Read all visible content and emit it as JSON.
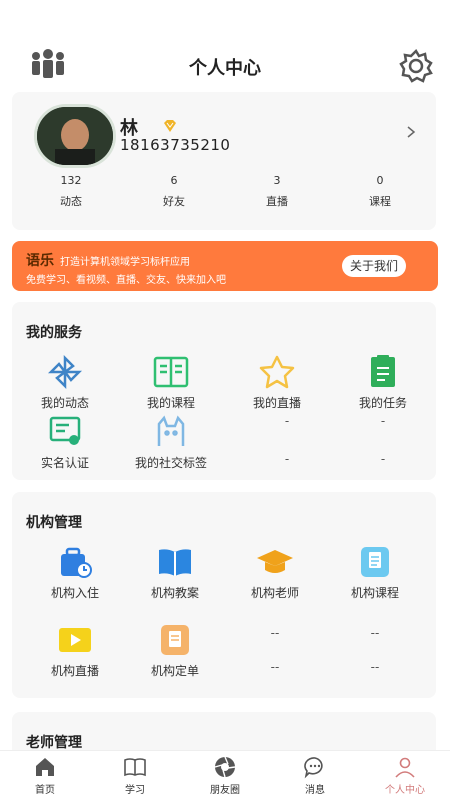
{
  "header": {
    "title": "个人中心",
    "left_icon": "people-icon",
    "right_icon": "gear-icon"
  },
  "profile": {
    "name": "林",
    "phone": "18163735210",
    "badge_icon": "vip-diamond-icon",
    "stats": [
      {
        "value": "132",
        "label": "动态"
      },
      {
        "value": "6",
        "label": "好友"
      },
      {
        "value": "3",
        "label": "直播"
      },
      {
        "value": "0",
        "label": "课程"
      }
    ]
  },
  "banner": {
    "brand": "语乐",
    "tagline": "打造计算机领域学习标杆应用",
    "subtitle": "免费学习、看视频、直播、交友、快来加入吧",
    "button": "关于我们"
  },
  "services": {
    "title": "我的服务",
    "items": [
      {
        "label": "我的动态",
        "icon": "pinwheel-icon"
      },
      {
        "label": "我的课程",
        "icon": "book-icon"
      },
      {
        "label": "我的直播",
        "icon": "star-icon"
      },
      {
        "label": "我的任务",
        "icon": "clipboard-icon"
      },
      {
        "label": "实名认证",
        "icon": "certificate-icon"
      },
      {
        "label": "我的社交标签",
        "icon": "cat-icon"
      }
    ],
    "placeholders": [
      "-",
      "-",
      "-",
      "-"
    ]
  },
  "org": {
    "title": "机构管理",
    "items": [
      {
        "label": "机构入住",
        "icon": "briefcase-clock-icon"
      },
      {
        "label": "机构教案",
        "icon": "open-book-icon"
      },
      {
        "label": "机构老师",
        "icon": "graduation-cap-icon"
      },
      {
        "label": "机构课程",
        "icon": "clipboard-icon"
      },
      {
        "label": "机构直播",
        "icon": "video-play-icon"
      },
      {
        "label": "机构定单",
        "icon": "order-icon"
      }
    ],
    "placeholders": [
      "--",
      "--",
      "--",
      "--"
    ]
  },
  "teacher": {
    "title": "老师管理"
  },
  "tabs": [
    {
      "label": "首页",
      "icon": "home-icon"
    },
    {
      "label": "学习",
      "icon": "book-icon"
    },
    {
      "label": "朋友圈",
      "icon": "aperture-icon"
    },
    {
      "label": "消息",
      "icon": "chat-icon"
    },
    {
      "label": "个人中心",
      "icon": "person-icon",
      "active": true
    }
  ],
  "colors": {
    "banner": "#ff7a3d",
    "active_tab": "#d27b7b",
    "card_bg": "#f7f7f7"
  }
}
